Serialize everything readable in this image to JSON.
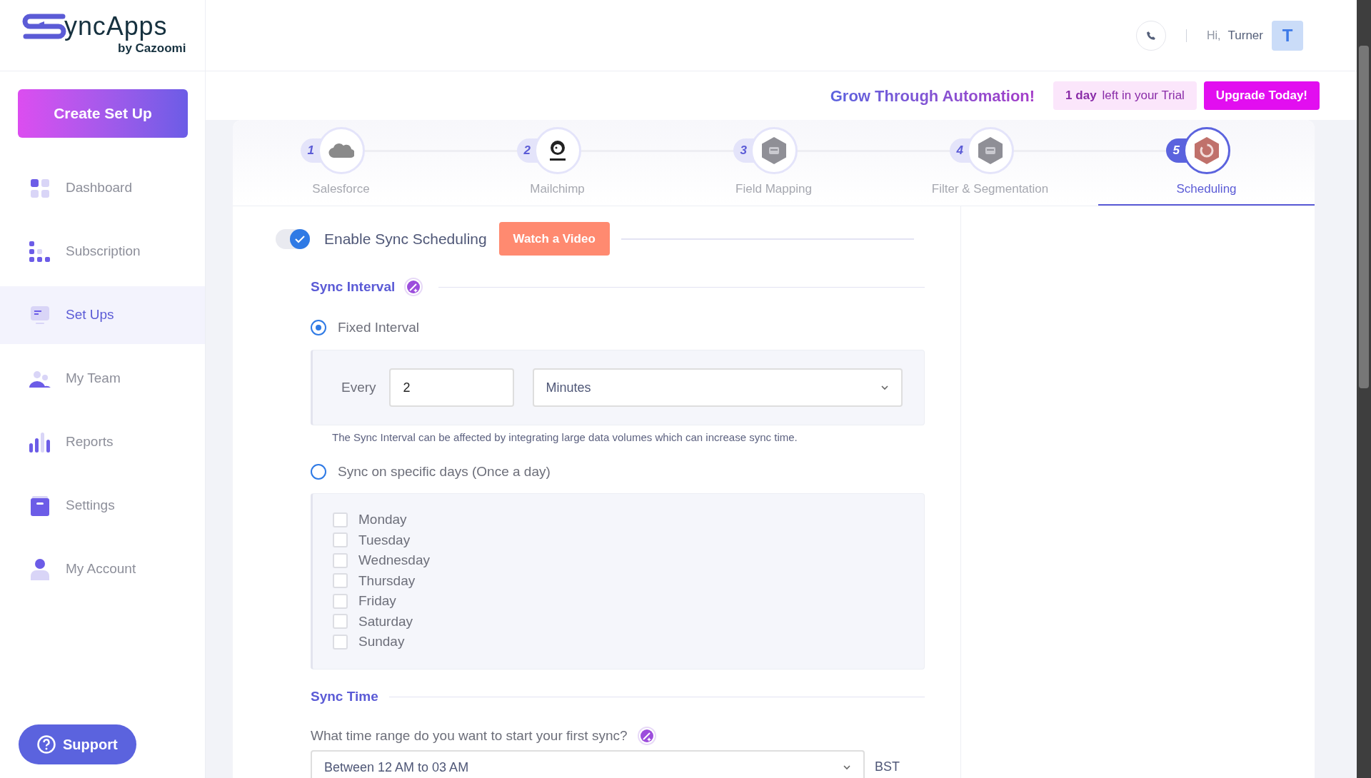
{
  "logo": {
    "name": "yncApps",
    "byline": "by Cazoomi"
  },
  "header": {
    "greeting": "Hi,",
    "user": "Turner",
    "avatar": "T"
  },
  "sidebar": {
    "create_button": "Create Set Up",
    "items": [
      {
        "label": "Dashboard",
        "selected": false
      },
      {
        "label": "Subscription",
        "selected": false
      },
      {
        "label": "Set Ups",
        "selected": true
      },
      {
        "label": "My Team",
        "selected": false
      },
      {
        "label": "Reports",
        "selected": false
      },
      {
        "label": "Settings",
        "selected": false
      },
      {
        "label": "My Account",
        "selected": false
      }
    ],
    "support": "Support"
  },
  "banner": {
    "slogan": "Grow Through Automation!",
    "trial_days": "1 day",
    "trial_text": "left in your Trial",
    "upgrade": "Upgrade Today!"
  },
  "steps": [
    {
      "number": "1",
      "label": "Salesforce",
      "selected": false
    },
    {
      "number": "2",
      "label": "Mailchimp",
      "selected": false
    },
    {
      "number": "3",
      "label": "Field Mapping",
      "selected": false
    },
    {
      "number": "4",
      "label": "Filter & Segmentation",
      "selected": false
    },
    {
      "number": "5",
      "label": "Scheduling",
      "selected": true
    }
  ],
  "enable": {
    "label": "Enable Sync Scheduling",
    "on": true,
    "video_button": "Watch a Video"
  },
  "sync_interval": {
    "heading": "Sync Interval",
    "fixed": {
      "label": "Fixed Interval",
      "selected": true,
      "every_label": "Every",
      "value": "2",
      "unit": "Minutes"
    },
    "note": "The Sync Interval can be affected by integrating large data volumes which can increase sync time.",
    "specific": {
      "label": "Sync on specific days (Once a day)",
      "selected": false,
      "days": [
        {
          "label": "Monday",
          "checked": false
        },
        {
          "label": "Tuesday",
          "checked": false
        },
        {
          "label": "Wednesday",
          "checked": false
        },
        {
          "label": "Thursday",
          "checked": false
        },
        {
          "label": "Friday",
          "checked": false
        },
        {
          "label": "Saturday",
          "checked": false
        },
        {
          "label": "Sunday",
          "checked": false
        }
      ]
    }
  },
  "sync_time": {
    "heading": "Sync Time",
    "question": "What time range do you want to start your first sync?",
    "range": "Between 12 AM to 03 AM",
    "timezone": "BST"
  }
}
